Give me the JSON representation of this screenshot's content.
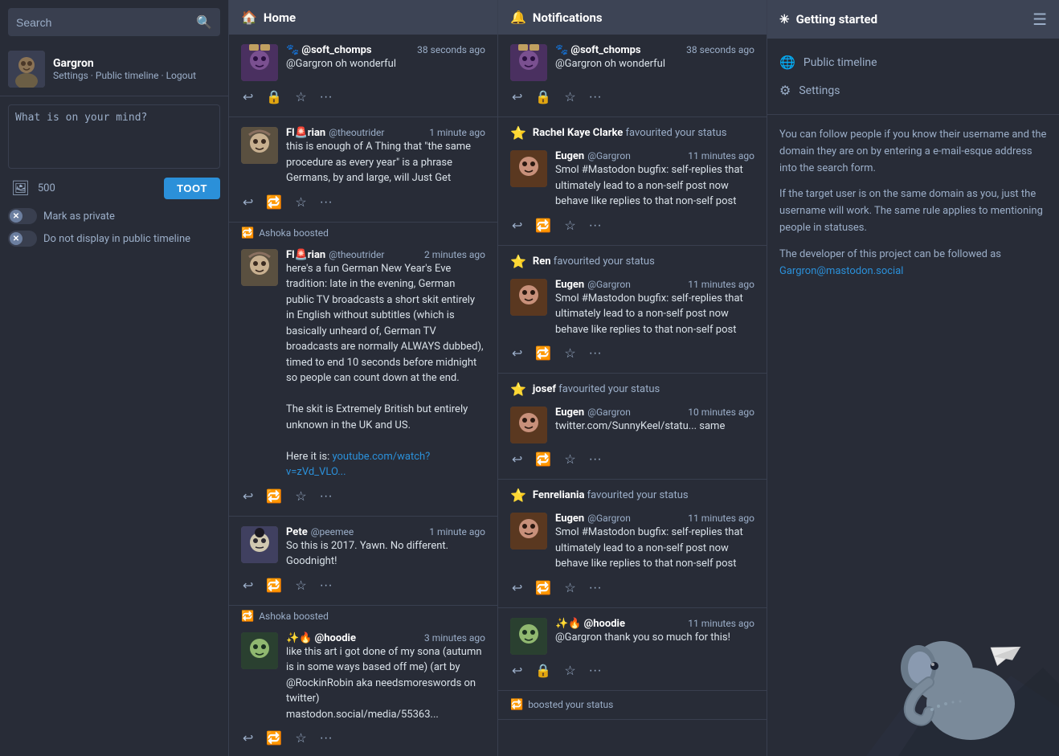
{
  "sidebar": {
    "search_placeholder": "Search",
    "user": {
      "name": "Gargron",
      "links": [
        "Settings",
        "Public timeline",
        "Logout"
      ]
    },
    "compose": {
      "placeholder": "What is on your mind?",
      "char_count": "500",
      "toot_label": "TOOT",
      "image_icon": "🖼",
      "options": [
        {
          "label": "Mark as private"
        },
        {
          "label": "Do not display in public timeline"
        }
      ]
    }
  },
  "home_column": {
    "title": "Home",
    "icon": "🏠",
    "statuses": [
      {
        "id": "s1",
        "avatar_color": "#6a5acd",
        "display_name": "🐾 @soft_chomps",
        "acct": "",
        "timestamp": "38 seconds ago",
        "content": "@Gargron oh wonderful",
        "actions": [
          "reply",
          "lock",
          "star",
          "more"
        ]
      },
      {
        "id": "s2",
        "is_boost": false,
        "display_name": "Fl🚨rian",
        "acct": "@theoutrider",
        "timestamp": "1 minute ago",
        "content": "this is enough of A Thing that \"the same procedure as every year\" is a phrase Germans, by and large, will Just Get",
        "actions": [
          "reply",
          "boost",
          "star",
          "more"
        ]
      },
      {
        "id": "s3_boost",
        "booster": "Ashoka boosted",
        "display_name": "Fl🚨rian",
        "acct": "@theoutrider",
        "timestamp": "2 minutes ago",
        "content": "here's a fun German New Year's Eve tradition: late in the evening, German public TV broadcasts a short skit entirely in English without subtitles (which is basically unheard of, German TV broadcasts are normally ALWAYS dubbed), timed to end 10 seconds before midnight so people can count down at the end.\n\nThe skit is Extremely British but entirely unknown in the UK and US.\n\nHere it is: youtube.com/watch?v=zVd_VLO...",
        "actions": [
          "reply",
          "boost",
          "star",
          "more"
        ]
      },
      {
        "id": "s4",
        "display_name": "Pete",
        "acct": "@peemee",
        "timestamp": "1 minute ago",
        "content": "So this is 2017. Yawn. No different. Goodnight!",
        "actions": [
          "reply",
          "boost",
          "star",
          "more"
        ]
      },
      {
        "id": "s5_boost",
        "booster": "Ashoka boosted",
        "display_name": "✨🔥 @hoodie",
        "acct": "",
        "timestamp": "3 minutes ago",
        "content": "like this art i got done of my sona (autumn is in some ways based off me) (art by @RockinRobin aka needsmoreswords on twitter)\nmastodon.social/media/55363...",
        "actions": [
          "reply",
          "boost",
          "star",
          "more"
        ]
      }
    ]
  },
  "notifications_column": {
    "title": "Notifications",
    "icon": "🔔",
    "items": [
      {
        "type": "mention",
        "avatar_color": "#6a5acd",
        "display_name": "🐾 @soft_chomps",
        "acct": "",
        "timestamp": "38 seconds ago",
        "content": "@Gargron oh wonderful",
        "actions": [
          "reply",
          "lock",
          "star",
          "more"
        ]
      },
      {
        "type": "favourite",
        "notif_icon": "⭐",
        "notif_label": "Rachel Kaye Clarke favourited your status",
        "avatar_color": "#b5651d",
        "src_name": "Eugen",
        "src_acct": "@Gargron",
        "src_timestamp": "11 minutes ago",
        "content": "Smol #Mastodon bugfix: self-replies that ultimately lead to a non-self post now behave like replies to that non-self post",
        "actions": [
          "reply",
          "boost",
          "star",
          "more"
        ]
      },
      {
        "type": "favourite",
        "notif_icon": "⭐",
        "notif_label": "Ren favourited your status",
        "avatar_color": "#b5651d",
        "src_name": "Eugen",
        "src_acct": "@Gargron",
        "src_timestamp": "11 minutes ago",
        "content": "Smol #Mastodon bugfix: self-replies that ultimately lead to a non-self post now behave like replies to that non-self post",
        "actions": [
          "reply",
          "boost",
          "star",
          "more"
        ]
      },
      {
        "type": "favourite",
        "notif_icon": "⭐",
        "notif_label": "josef favourited your status",
        "avatar_color": "#b5651d",
        "src_name": "Eugen",
        "src_acct": "@Gargron",
        "src_timestamp": "10 minutes ago",
        "content": "twitter.com/SunnyKeel/statu... same",
        "actions": [
          "reply",
          "boost",
          "star",
          "more"
        ]
      },
      {
        "type": "favourite",
        "notif_icon": "⭐",
        "notif_label": "Fenreliania favourited your status",
        "avatar_color": "#b5651d",
        "src_name": "Eugen",
        "src_acct": "@Gargron",
        "src_timestamp": "11 minutes ago",
        "content": "Smol #Mastodon bugfix: self-replies that ultimately lead to a non-self post now behave like replies to that non-self post",
        "actions": [
          "reply",
          "boost",
          "star",
          "more"
        ]
      },
      {
        "type": "mention",
        "avatar_color": "#4a7c59",
        "display_name": "✨🔥 @hoodie",
        "acct": "",
        "timestamp": "11 minutes ago",
        "content": "@Gargron thank you so much for this!",
        "actions": [
          "reply",
          "lock",
          "star",
          "more"
        ]
      },
      {
        "type": "boost_partial",
        "notif_icon": "🔁",
        "notif_label": "boosted your status"
      }
    ]
  },
  "right_panel": {
    "title": "Getting started",
    "icon": "✳",
    "menu_icon": "☰",
    "nav_items": [
      {
        "icon": "🌐",
        "label": "Public timeline"
      },
      {
        "icon": "⚙",
        "label": "Settings"
      }
    ],
    "help_text": [
      "You can follow people if you know their username and the domain they are on by entering a e-mail-esque address into the search form.",
      "If the target user is on the same domain as you, just the username will work. The same rule applies to mentioning people in statuses.",
      "The developer of this project can be followed as Gargron@mastodon.social"
    ]
  }
}
